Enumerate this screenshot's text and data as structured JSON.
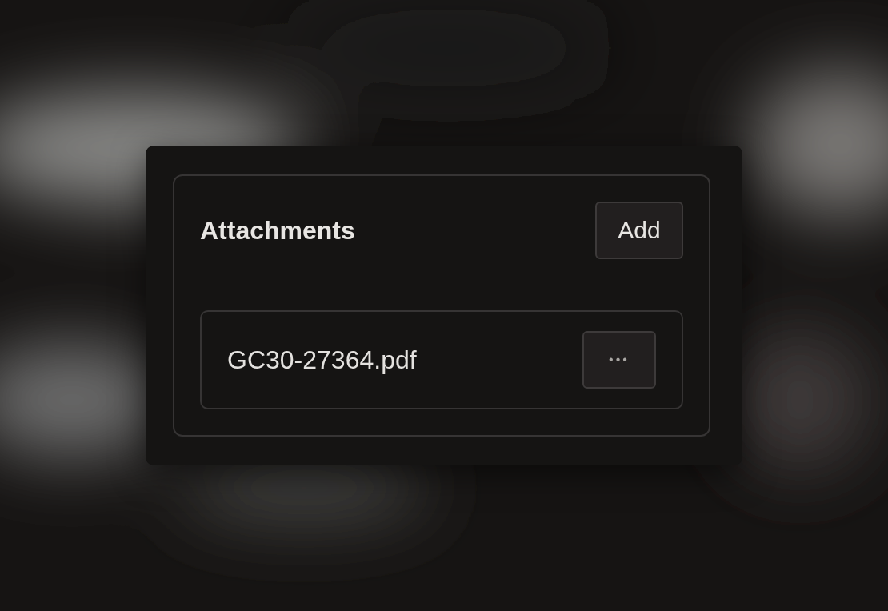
{
  "attachments": {
    "title": "Attachments",
    "add_button": "Add",
    "files": [
      {
        "name": "GC30-27364.pdf",
        "menu": "•••"
      }
    ]
  }
}
